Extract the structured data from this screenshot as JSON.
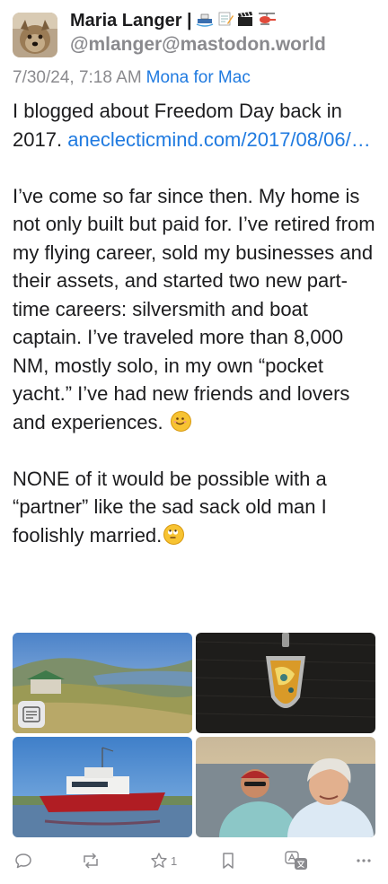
{
  "author": {
    "display_name": "Maria Langer |",
    "handle": "@mlanger@mastodon.world",
    "name_emojis": [
      "ship-icon",
      "memo-icon",
      "clapper-icon",
      "helicopter-icon"
    ]
  },
  "meta": {
    "timestamp": "7/30/24, 7:18 AM",
    "client": "Mona for Mac"
  },
  "post": {
    "line1_text": "I blogged about Freedom Day back in 2017.",
    "link_text": "aneclecticmind.com/2017/08/06/…",
    "paragraph2": "I’ve come so far since then. My home is not only built but paid for. I’ve retired from my flying career, sold my businesses and their assets, and started two new part-time careers: silversmith and boat captain. I’ve traveled more than 8,000 NM, mostly solo, in my own “pocket yacht.” I’ve had new friends and lovers and experiences.",
    "paragraph3": "NONE of it would be possible with a “partner” like the sad sack old man I foolishly married."
  },
  "media": [
    "landscape-photo",
    "pendant-photo",
    "boat-photo",
    "selfie-photo"
  ],
  "actions": {
    "favourite_count": "1"
  },
  "colors": {
    "accent": "#1f7ae0",
    "secondary_text": "#8a8a8e"
  }
}
